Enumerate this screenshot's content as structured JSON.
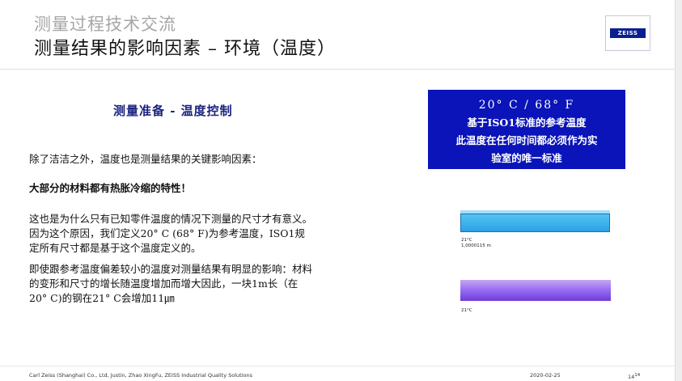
{
  "header": {
    "subtitle": "测量过程技术交流",
    "title": "测量结果的影响因素  –  环境（温度）",
    "logo_text": "ZEISS"
  },
  "section_title": "测量准备 - 温度控制",
  "paragraphs": {
    "p1": "除了洁洁之外，温度也是测量结果的关键影响因素：",
    "p2": "大部分的材料都有热胀冷缩的特性！",
    "p3_l1": "这也是为什么只有已知零件温度的情况下测量的尺寸才有意义。",
    "p3_l2": "因为这个原因，我们定义20°  C (68°  F)为参考温度，ISO1规",
    "p3_l3": "定所有尺寸都是基于这个温度定义的。",
    "p4_l1": "即使跟参考温度偏差较小的温度对测量结果有明显的影响：材料",
    "p4_l2": "的变形和尺寸的增长随温度增加而增大因此，一块1m长（在",
    "p4_l3": "20° C)的钢在21° C会增加11㎛"
  },
  "infobox": {
    "line1": "20° C / 68° F",
    "line2": "基于ISO1标准的参考温度",
    "line3": "此温度在任何时间都必须作为实",
    "line4": "验室的唯一标准"
  },
  "bars": {
    "bar1_temp": "21°C",
    "bar1_length": "1,0000115 m",
    "bar2_temp": "21°C"
  },
  "footer": {
    "company": "Carl Zeiss (Shanghai) Co., Ltd, Justin, Zhao XingFu, ZEISS Industrial Quality Solutions",
    "date": "2020-02-25",
    "page": "14",
    "page_sup": "14"
  },
  "colors": {
    "infobox_bg": "#0a14b8",
    "section_title": "#1a237e",
    "zeiss_blue": "#0a1f8f"
  }
}
